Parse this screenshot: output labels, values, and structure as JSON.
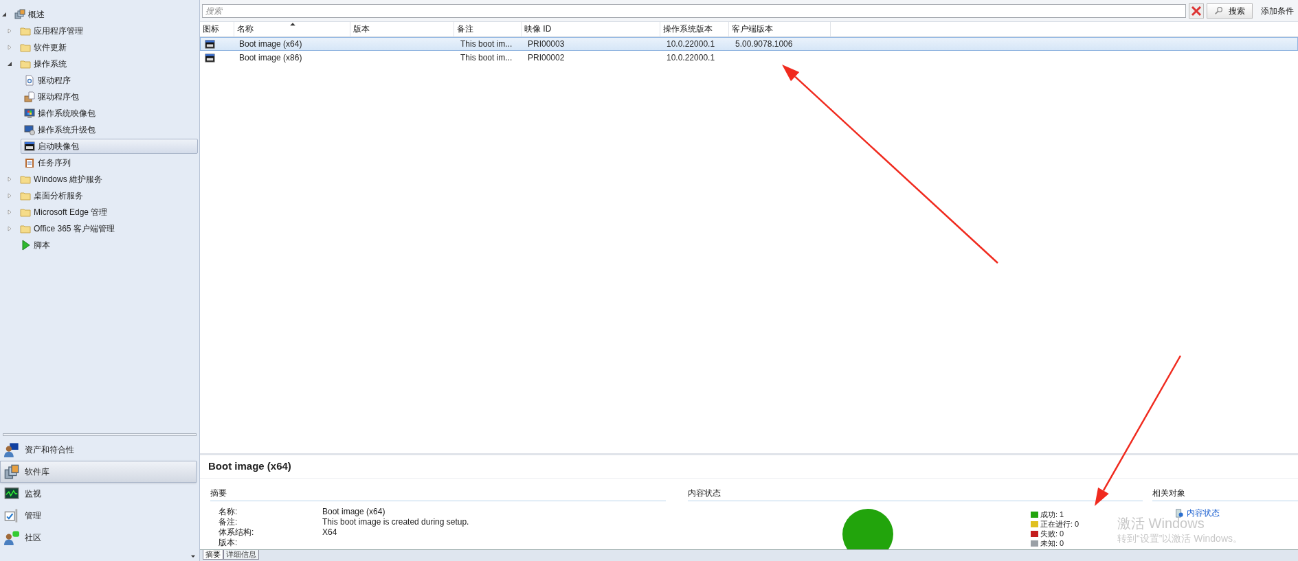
{
  "navigation_tree": [
    {
      "label": "概述",
      "kind": "overview",
      "expanded": true,
      "selected": false,
      "children": [
        {
          "label": "应用程序管理",
          "kind": "folder",
          "expanded": false,
          "selected": false
        },
        {
          "label": "软件更新",
          "kind": "folder",
          "expanded": false,
          "selected": false
        },
        {
          "label": "操作系统",
          "kind": "folder",
          "expanded": true,
          "selected": false,
          "children": [
            {
              "label": "驱动程序",
              "kind": "driver",
              "selected": false
            },
            {
              "label": "驱动程序包",
              "kind": "driver-package",
              "selected": false
            },
            {
              "label": "操作系统映像包",
              "kind": "os-image",
              "selected": false
            },
            {
              "label": "操作系统升级包",
              "kind": "os-upgrade",
              "selected": false
            },
            {
              "label": "启动映像包",
              "kind": "boot-image",
              "selected": true
            },
            {
              "label": "任务序列",
              "kind": "task-sequence",
              "selected": false
            }
          ]
        },
        {
          "label": "Windows 維护服务",
          "kind": "folder",
          "expanded": false,
          "selected": false
        },
        {
          "label": "桌面分析服务",
          "kind": "folder",
          "expanded": false,
          "selected": false
        },
        {
          "label": "Microsoft Edge 管理",
          "kind": "folder",
          "expanded": false,
          "selected": false
        },
        {
          "label": "Office 365 客户端管理",
          "kind": "folder",
          "expanded": false,
          "selected": false
        },
        {
          "label": "脚本",
          "kind": "script",
          "selected": false
        }
      ]
    }
  ],
  "workspaces": [
    {
      "label": "资产和符合性",
      "kind": "assets",
      "selected": false
    },
    {
      "label": "软件库",
      "kind": "library",
      "selected": true
    },
    {
      "label": "监视",
      "kind": "monitor",
      "selected": false
    },
    {
      "label": "管理",
      "kind": "admin",
      "selected": false
    },
    {
      "label": "社区",
      "kind": "community",
      "selected": false
    }
  ],
  "search": {
    "placeholder": "搜索",
    "button": "搜索",
    "add_criteria": "添加条件"
  },
  "table": {
    "columns": [
      {
        "label": "图标",
        "sorted": false
      },
      {
        "label": "名称",
        "sorted": true
      },
      {
        "label": "版本",
        "sorted": false
      },
      {
        "label": "备注",
        "sorted": false
      },
      {
        "label": "映像 ID",
        "sorted": false
      },
      {
        "label": "操作系统版本",
        "sorted": false
      },
      {
        "label": "客户端版本",
        "sorted": false
      }
    ],
    "rows": [
      {
        "selected": true,
        "cells": [
          "",
          "Boot image (x64)",
          "",
          "This boot im...",
          "PRI00003",
          "10.0.22000.1",
          "5.00.9078.1006"
        ]
      },
      {
        "selected": false,
        "cells": [
          "",
          "Boot image (x86)",
          "",
          "This boot im...",
          "PRI00002",
          "10.0.22000.1",
          ""
        ]
      }
    ]
  },
  "details": {
    "title": "Boot image (x64)",
    "summary": {
      "heading": "摘要",
      "fields": [
        {
          "label": "名称:",
          "value": "Boot image (x64)"
        },
        {
          "label": "备注:",
          "value": "This boot image is created during setup."
        },
        {
          "label": "体系结构:",
          "value": "X64"
        },
        {
          "label": "版本:"
        }
      ]
    },
    "content_status": {
      "heading": "内容状态",
      "chart_data": {
        "type": "pie",
        "values": [
          1,
          0,
          0,
          0
        ]
      },
      "legend": [
        {
          "label": "成功:",
          "count": "1",
          "color": "#22a40c"
        },
        {
          "label": "正在进行:",
          "count": "0",
          "color": "#e0c020"
        },
        {
          "label": "失败:",
          "count": "0",
          "color": "#c41e1e"
        },
        {
          "label": "未知:",
          "count": "0",
          "color": "#9aa0a6"
        }
      ]
    },
    "related": {
      "heading": "相关对象",
      "links": [
        "内容状态"
      ]
    },
    "tabs": [
      {
        "label": "摘要",
        "selected": true
      },
      {
        "label": "详细信息",
        "selected": false
      }
    ]
  },
  "activation_notice": {
    "title": "激活 Windows",
    "text": "转到“设置”以激活 Windows。"
  }
}
